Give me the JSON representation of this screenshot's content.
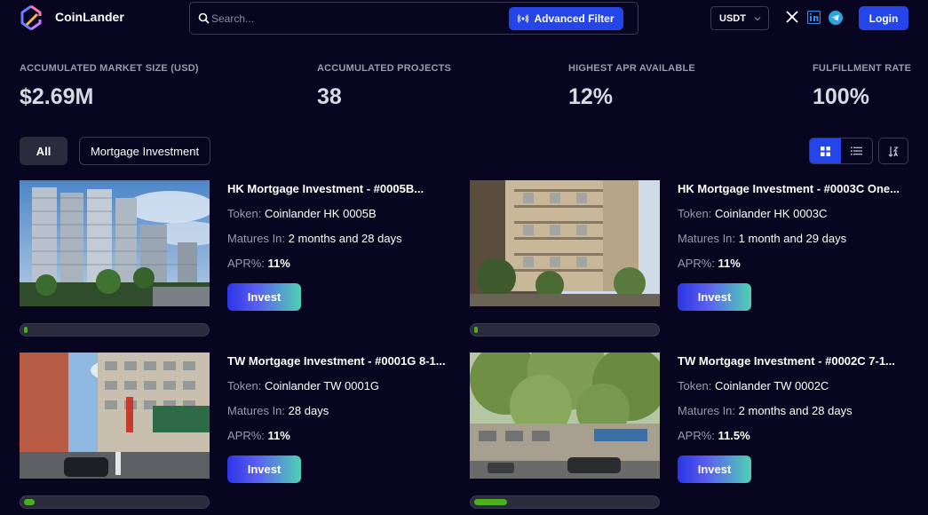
{
  "header": {
    "brand": "CoinLander",
    "search_placeholder": "Search...",
    "advanced_filter_label": "Advanced Filter",
    "currency": "USDT",
    "login_label": "Login"
  },
  "stats": [
    {
      "label": "ACCUMULATED MARKET SIZE (USD)",
      "value": "$2.69M"
    },
    {
      "label": "ACCUMULATED PROJECTS",
      "value": "38"
    },
    {
      "label": "HIGHEST APR AVAILABLE",
      "value": "12%"
    },
    {
      "label": "FULFILLMENT RATE",
      "value": "100%"
    }
  ],
  "filters": {
    "all_label": "All",
    "mortgage_label": "Mortgage Investment"
  },
  "labels": {
    "token": "Token:",
    "matures": "Matures In:",
    "apr": "APR%:",
    "invest": "Invest"
  },
  "listings": [
    {
      "title": "HK Mortgage Investment - #0005B...",
      "token": "Coinlander HK 0005B",
      "matures": "2 months and 28 days",
      "apr": "11%",
      "progress": 0.02
    },
    {
      "title": "HK Mortgage Investment - #0003C One...",
      "token": "Coinlander HK 0003C",
      "matures": "1 month and 29 days",
      "apr": "11%",
      "progress": 0.02
    },
    {
      "title": "TW Mortgage Investment - #0001G 8-1...",
      "token": "Coinlander TW 0001G",
      "matures": "28 days",
      "apr": "11%",
      "progress": 0.06
    },
    {
      "title": "TW Mortgage Investment - #0002C 7-1...",
      "token": "Coinlander TW 0002C",
      "matures": "2 months and 28 days",
      "apr": "11.5%",
      "progress": 0.18
    }
  ],
  "colors": {
    "background": "#07051f",
    "accent": "#2446e8",
    "progress": "#4caf1e",
    "muted_text": "#9a9aad"
  }
}
